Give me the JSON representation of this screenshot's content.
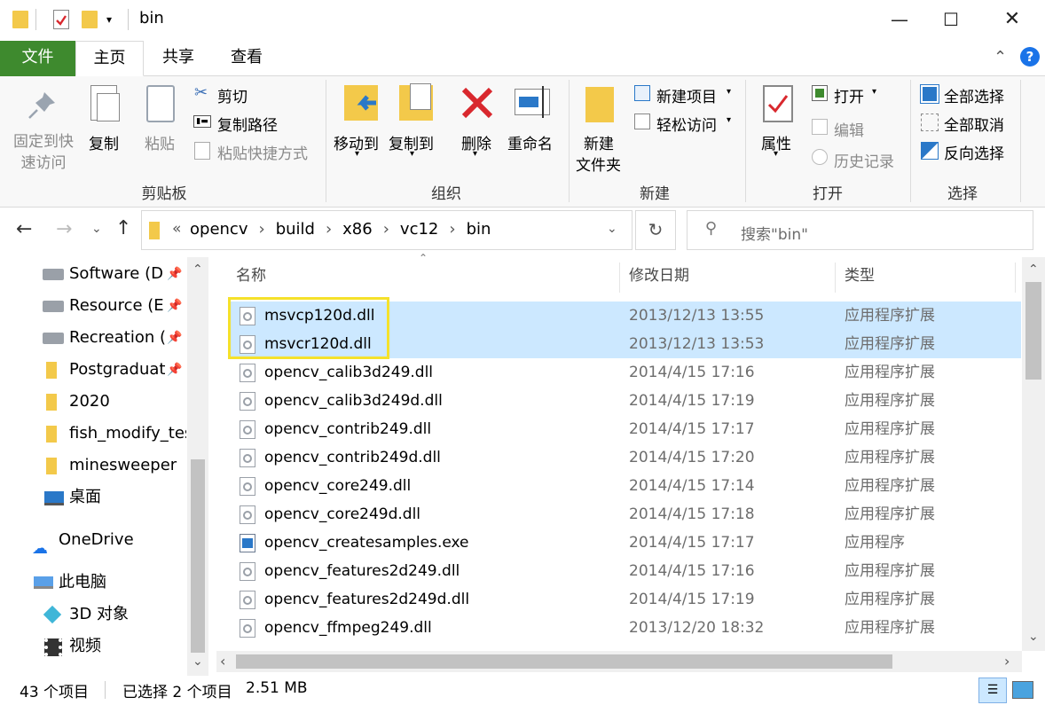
{
  "window": {
    "title": "bin"
  },
  "tabs": {
    "file": "文件",
    "home": "主页",
    "share": "共享",
    "view": "查看"
  },
  "ribbon": {
    "clipboard": {
      "pin": "固定到快\n速访问",
      "pin_line1": "固定到快",
      "pin_line2": "速访问",
      "copy": "复制",
      "paste": "粘贴",
      "cut": "剪切",
      "copy_path": "复制路径",
      "paste_shortcut": "粘贴快捷方式",
      "label": "剪贴板"
    },
    "organize": {
      "move_to": "移动到",
      "copy_to": "复制到",
      "delete": "删除",
      "rename": "重命名",
      "label": "组织"
    },
    "new": {
      "new_item": "新建项目",
      "easy_access": "轻松访问",
      "new_folder_line1": "新建",
      "new_folder_line2": "文件夹",
      "label": "新建"
    },
    "open": {
      "properties": "属性",
      "open": "打开",
      "edit": "编辑",
      "history": "历史记录",
      "label": "打开"
    },
    "select": {
      "select_all": "全部选择",
      "select_none": "全部取消",
      "invert": "反向选择",
      "label": "选择"
    }
  },
  "address": {
    "prefix": "«",
    "crumbs": [
      "opencv",
      "build",
      "x86",
      "vc12",
      "bin"
    ],
    "search_placeholder": "搜索\"bin\""
  },
  "sidebar": {
    "items": [
      {
        "label": "Software (D:)",
        "kind": "drive",
        "pinned": true
      },
      {
        "label": "Resource (E:)",
        "kind": "drive",
        "pinned": true
      },
      {
        "label": "Recreation (F:)",
        "kind": "drive",
        "pinned": true
      },
      {
        "label": "Postgraduate",
        "kind": "folder",
        "pinned": true
      },
      {
        "label": "2020",
        "kind": "folder",
        "pinned": false
      },
      {
        "label": "fish_modify_test",
        "kind": "folder",
        "pinned": false
      },
      {
        "label": "minesweeper",
        "kind": "folder",
        "pinned": false
      },
      {
        "label": "桌面",
        "kind": "desktop",
        "pinned": false
      },
      {
        "label": "OneDrive",
        "kind": "cloud",
        "pinned": false
      },
      {
        "label": "此电脑",
        "kind": "pc",
        "pinned": false
      },
      {
        "label": "3D 对象",
        "kind": "3d",
        "pinned": false
      },
      {
        "label": "视频",
        "kind": "video",
        "pinned": false
      }
    ]
  },
  "columns": {
    "name": "名称",
    "date": "修改日期",
    "type": "类型"
  },
  "files": [
    {
      "name": "msvcp120d.dll",
      "date": "2013/12/13 13:55",
      "type": "应用程序扩展",
      "selected": true
    },
    {
      "name": "msvcr120d.dll",
      "date": "2013/12/13 13:53",
      "type": "应用程序扩展",
      "selected": true
    },
    {
      "name": "opencv_calib3d249.dll",
      "date": "2014/4/15 17:16",
      "type": "应用程序扩展",
      "selected": false
    },
    {
      "name": "opencv_calib3d249d.dll",
      "date": "2014/4/15 17:19",
      "type": "应用程序扩展",
      "selected": false
    },
    {
      "name": "opencv_contrib249.dll",
      "date": "2014/4/15 17:17",
      "type": "应用程序扩展",
      "selected": false
    },
    {
      "name": "opencv_contrib249d.dll",
      "date": "2014/4/15 17:20",
      "type": "应用程序扩展",
      "selected": false
    },
    {
      "name": "opencv_core249.dll",
      "date": "2014/4/15 17:14",
      "type": "应用程序扩展",
      "selected": false
    },
    {
      "name": "opencv_core249d.dll",
      "date": "2014/4/15 17:18",
      "type": "应用程序扩展",
      "selected": false
    },
    {
      "name": "opencv_createsamples.exe",
      "date": "2014/4/15 17:17",
      "type": "应用程序",
      "selected": false
    },
    {
      "name": "opencv_features2d249.dll",
      "date": "2014/4/15 17:16",
      "type": "应用程序扩展",
      "selected": false
    },
    {
      "name": "opencv_features2d249d.dll",
      "date": "2014/4/15 17:19",
      "type": "应用程序扩展",
      "selected": false
    },
    {
      "name": "opencv_ffmpeg249.dll",
      "date": "2013/12/20 18:32",
      "type": "应用程序扩展",
      "selected": false
    }
  ],
  "status": {
    "count": "43 个项目",
    "selection": "已选择 2 个项目",
    "size": "2.51 MB"
  },
  "colors": {
    "accent_green": "#3e8a2e",
    "selection_bg": "#cce8ff",
    "highlight_box": "#f5e12a",
    "help_blue": "#1a73e8"
  }
}
